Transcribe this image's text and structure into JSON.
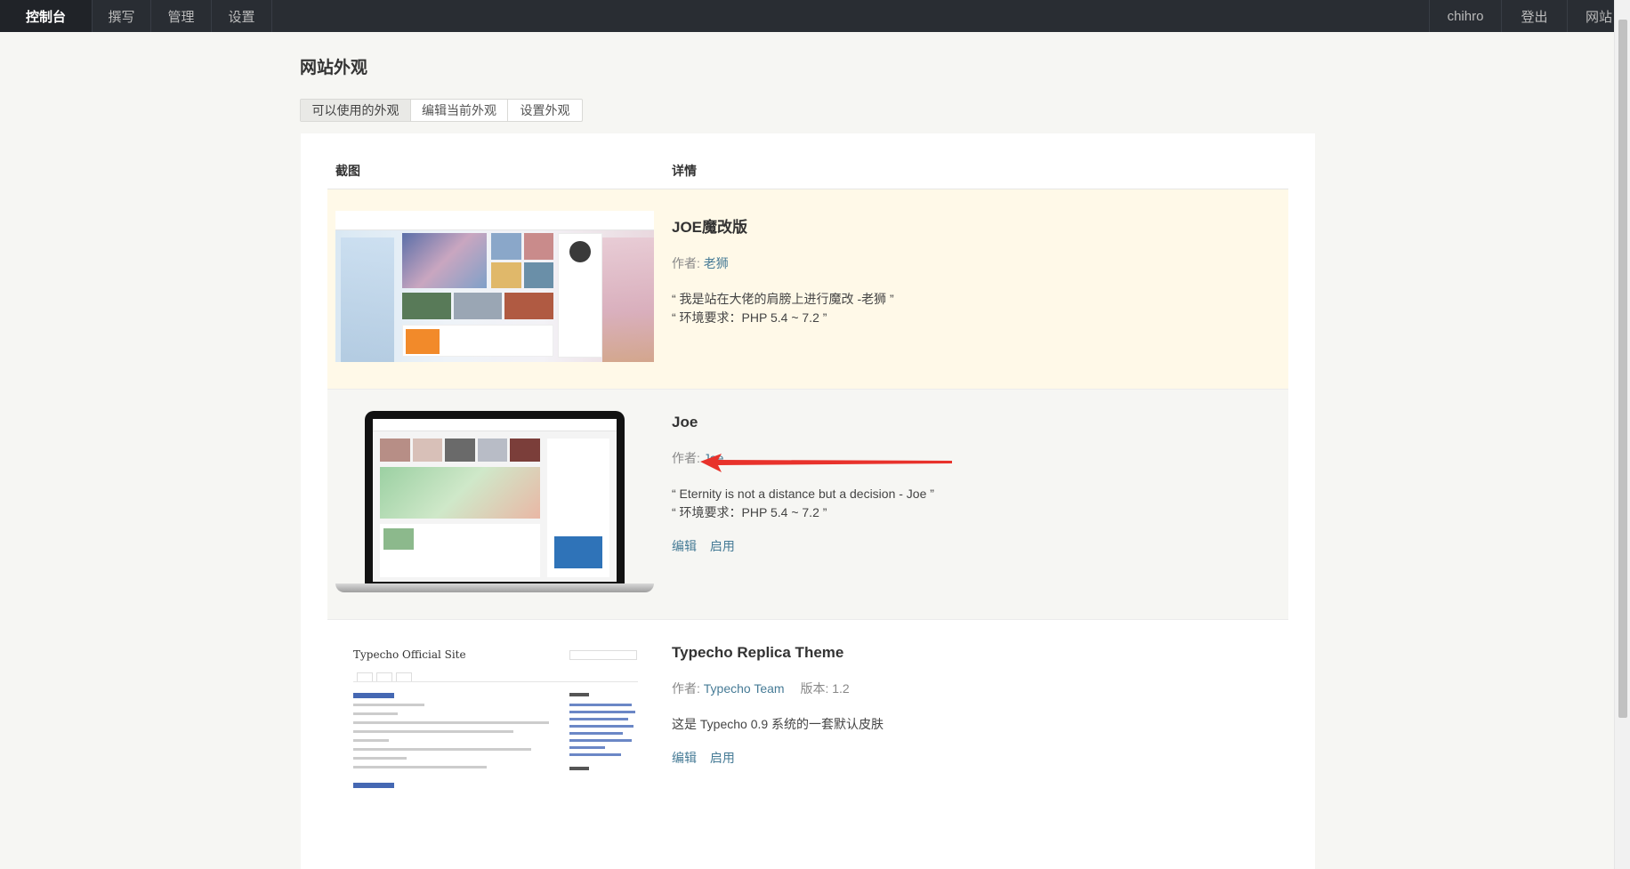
{
  "nav": {
    "left": [
      {
        "label": "控制台",
        "active": true
      },
      {
        "label": "撰写",
        "active": false
      },
      {
        "label": "管理",
        "active": false
      },
      {
        "label": "设置",
        "active": false
      }
    ],
    "right": [
      {
        "label": "chihro"
      },
      {
        "label": "登出"
      },
      {
        "label": "网站"
      }
    ]
  },
  "page": {
    "title": "网站外观",
    "tabs": [
      {
        "label": "可以使用的外观",
        "active": true
      },
      {
        "label": "编辑当前外观",
        "active": false
      },
      {
        "label": "设置外观",
        "active": false
      }
    ]
  },
  "table": {
    "headers": {
      "screenshot": "截图",
      "details": "详情"
    },
    "themes": [
      {
        "name": "JOE魔改版",
        "author_label": "作者:",
        "author": "老狮",
        "description_lines": [
          "“ 我是站在大佬的肩膀上进行魔改 -老狮 ”",
          "“ 环境要求：PHP 5.4 ~ 7.2 ”"
        ],
        "current": true,
        "actions": []
      },
      {
        "name": "Joe",
        "author_label": "作者:",
        "author": "Joe",
        "description_lines": [
          "“ Eternity is not a distance but a decision - Joe ”",
          "“ 环境要求：PHP 5.4 ~ 7.2 ”"
        ],
        "current": false,
        "actions": [
          "编辑",
          "启用"
        ]
      },
      {
        "name": "Typecho Replica Theme",
        "author_label": "作者:",
        "author": "Typecho Team",
        "version": "版本: 1.2",
        "description_lines": [
          "这是 Typecho 0.9 系统的一套默认皮肤"
        ],
        "current": false,
        "actions": [
          "编辑",
          "启用"
        ],
        "thumbnail_title": "Typecho Official Site"
      }
    ]
  },
  "colors": {
    "topbar": "#292d33",
    "link": "#467b96",
    "current_row": "#fff9e8",
    "annotation_arrow": "#e8322b"
  }
}
